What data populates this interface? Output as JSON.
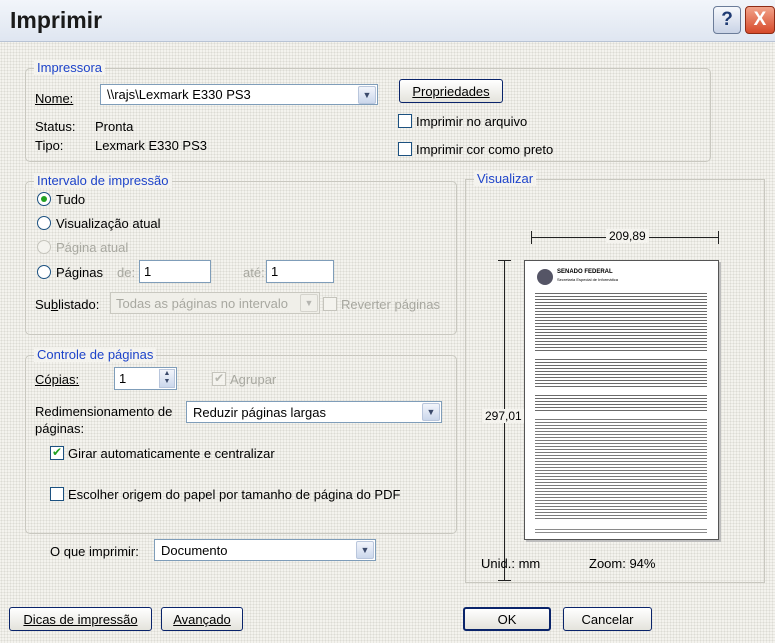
{
  "window": {
    "title": "Imprimir",
    "help": "?",
    "close": "X"
  },
  "printer": {
    "legend": "Impressora",
    "name_label": "Nome:",
    "name_value": "\\\\rajs\\Lexmark E330 PS3",
    "status_label": "Status:",
    "status_value": "Pronta",
    "type_label": "Tipo:",
    "type_value": "Lexmark E330 PS3",
    "properties_button": "Propriedades",
    "print_to_file": "Imprimir no arquivo",
    "print_color_as_black": "Imprimir cor como preto"
  },
  "range": {
    "legend": "Intervalo de impressão",
    "all": "Tudo",
    "current_view": "Visualização atual",
    "current_page": "Página atual",
    "pages": "Páginas",
    "from_label": "de:",
    "from_value": "1",
    "to_label": "até:",
    "to_value": "1",
    "subset_label": "Sublistado:",
    "subset_value": "Todas as páginas no intervalo",
    "reverse_pages": "Reverter páginas"
  },
  "handling": {
    "legend": "Controle de páginas",
    "copies_label": "Cópias:",
    "copies_value": "1",
    "collate": "Agrupar",
    "scaling_label_1": "Redimensionamento de",
    "scaling_label_2": "páginas:",
    "scaling_value": "Reduzir páginas largas",
    "auto_rotate": "Girar automaticamente e centralizar",
    "paper_source": "Escolher origem do papel por tamanho de página do PDF"
  },
  "what": {
    "label": "O que imprimir:",
    "value": "Documento"
  },
  "preview": {
    "legend": "Visualizar",
    "width": "209,89",
    "height": "297,01",
    "units": "Unid.: mm",
    "zoom": "Zoom:  94%",
    "doc_title": "SENADO FEDERAL",
    "doc_sub": "Secretaria Especial de Informática"
  },
  "buttons": {
    "tips": "Dicas de impressão",
    "advanced": "Avançado",
    "ok": "OK",
    "cancel": "Cancelar"
  }
}
